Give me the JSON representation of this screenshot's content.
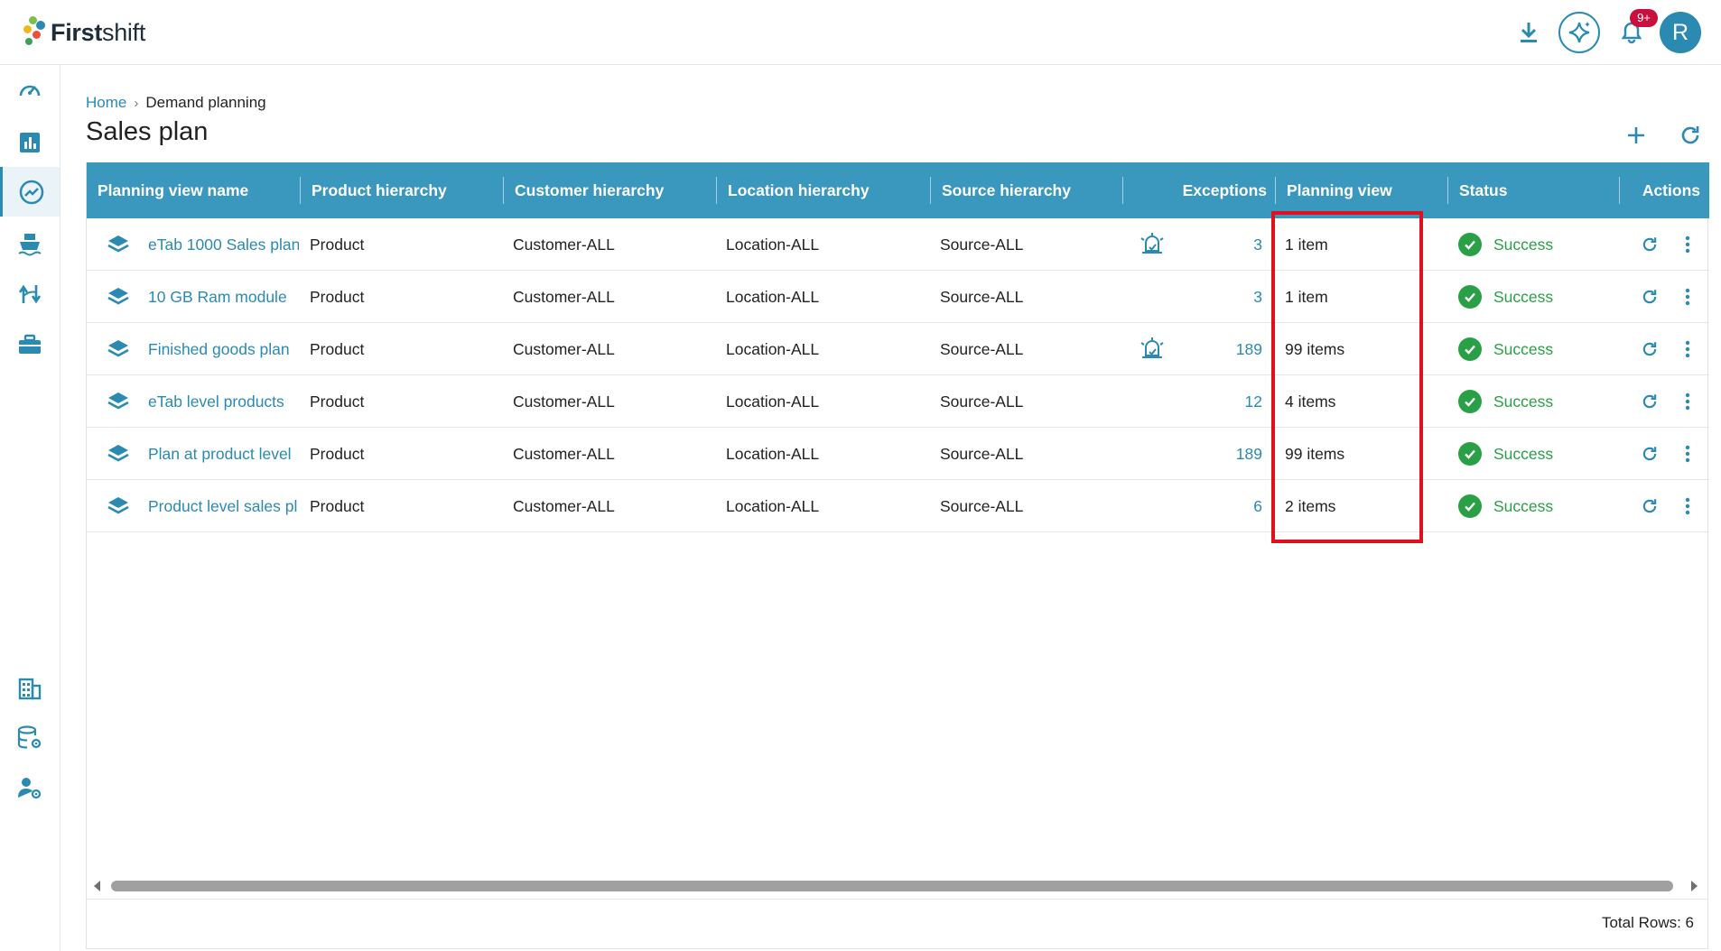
{
  "app": {
    "logo_text_bold": "First",
    "logo_text_light": "shift",
    "notifications_badge": "9+",
    "avatar_initial": "R",
    "accent_color": "#3a97bd",
    "success_color": "#2aa046",
    "highlight_color": "#e0101c"
  },
  "breadcrumb": {
    "home": "Home",
    "separator": "›",
    "current": "Demand planning"
  },
  "page": {
    "title": "Sales plan"
  },
  "table": {
    "columns": {
      "name": "Planning view name",
      "product": "Product hierarchy",
      "customer": "Customer hierarchy",
      "location": "Location hierarchy",
      "source": "Source hierarchy",
      "exceptions": "Exceptions",
      "planning_view": "Planning view",
      "status": "Status",
      "actions": "Actions"
    },
    "rows": [
      {
        "name": "eTab 1000 Sales plan",
        "product": "Product",
        "customer": "Customer-ALL",
        "location": "Location-ALL",
        "source": "Source-ALL",
        "exception_alert": true,
        "exceptions": "3",
        "planning_view": "1 item",
        "status": "Success"
      },
      {
        "name": "10 GB Ram module",
        "product": "Product",
        "customer": "Customer-ALL",
        "location": "Location-ALL",
        "source": "Source-ALL",
        "exception_alert": false,
        "exceptions": "3",
        "planning_view": "1 item",
        "status": "Success"
      },
      {
        "name": "Finished goods plan",
        "product": "Product",
        "customer": "Customer-ALL",
        "location": "Location-ALL",
        "source": "Source-ALL",
        "exception_alert": true,
        "exceptions": "189",
        "planning_view": "99 items",
        "status": "Success"
      },
      {
        "name": "eTab level products",
        "product": "Product",
        "customer": "Customer-ALL",
        "location": "Location-ALL",
        "source": "Source-ALL",
        "exception_alert": false,
        "exceptions": "12",
        "planning_view": "4 items",
        "status": "Success"
      },
      {
        "name": "Plan at product level",
        "product": "Product",
        "customer": "Customer-ALL",
        "location": "Location-ALL",
        "source": "Source-ALL",
        "exception_alert": false,
        "exceptions": "189",
        "planning_view": "99 items",
        "status": "Success"
      },
      {
        "name": "Product level sales pl",
        "product": "Product",
        "customer": "Customer-ALL",
        "location": "Location-ALL",
        "source": "Source-ALL",
        "exception_alert": false,
        "exceptions": "6",
        "planning_view": "2 items",
        "status": "Success"
      }
    ]
  },
  "footer": {
    "total_rows": "Total Rows: 6"
  },
  "icons": {
    "top": [
      "download-icon",
      "ai-sparkle-icon",
      "bell-icon"
    ],
    "sidebar": [
      "dashboard-gauge-icon",
      "bar-chart-icon",
      "trend-icon",
      "ship-icon",
      "route-icon",
      "briefcase-icon",
      "building-icon",
      "database-settings-icon",
      "user-settings-icon"
    ],
    "row": [
      "layers-icon",
      "alarm-alert-icon",
      "check-circle-icon",
      "refresh-icon",
      "more-vertical-icon"
    ]
  }
}
